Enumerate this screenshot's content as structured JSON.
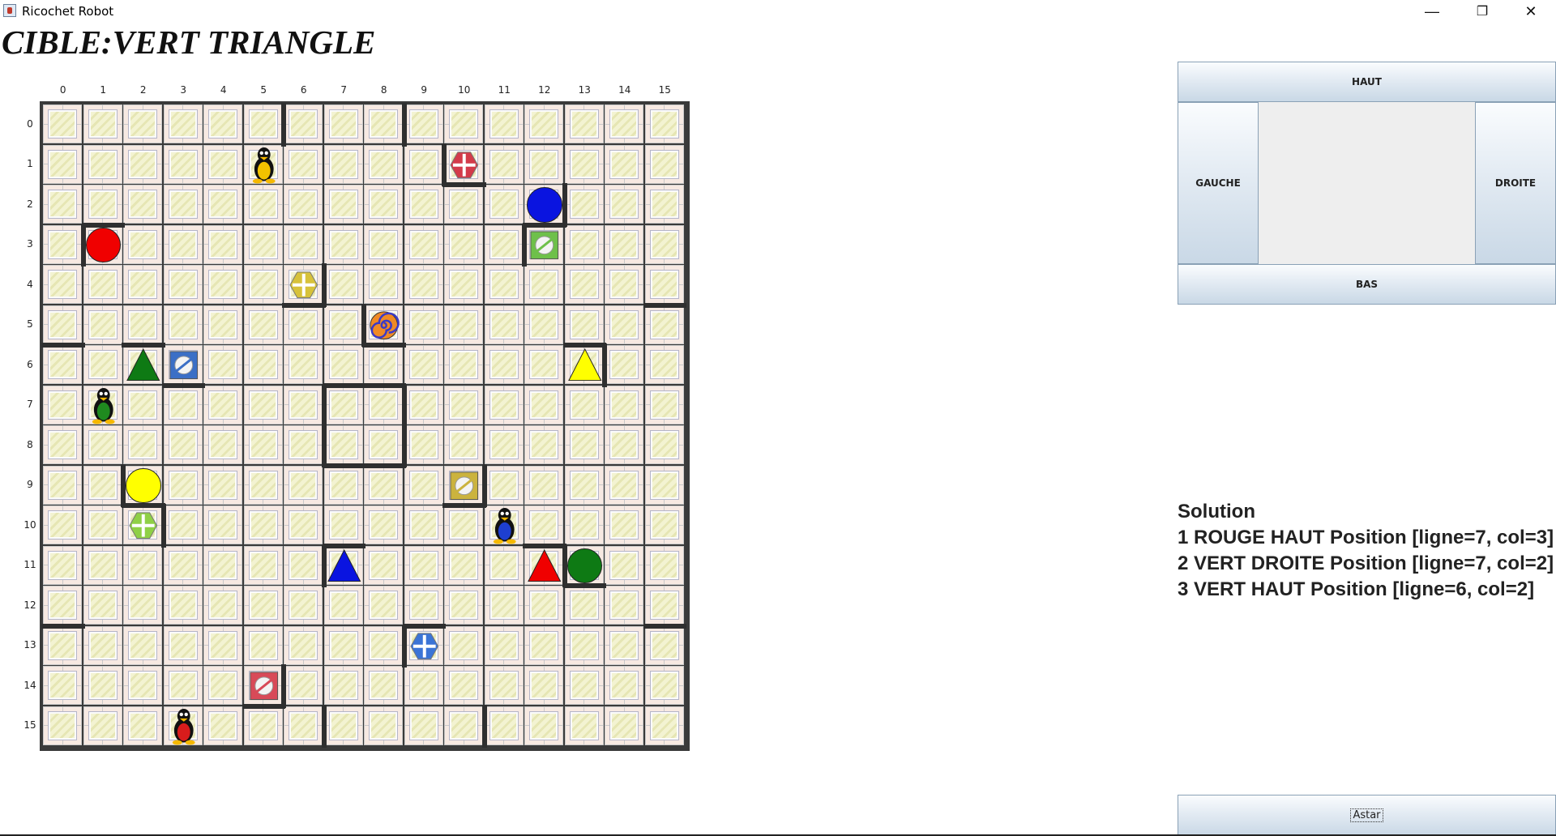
{
  "window": {
    "title": "Ricochet Robot",
    "minimize_glyph": "—",
    "restore_glyph": "❐",
    "close_glyph": "✕"
  },
  "cible_text": "CIBLE:VERT TRIANGLE",
  "board": {
    "size": 16,
    "column_labels": [
      "0",
      "1",
      "2",
      "3",
      "4",
      "5",
      "6",
      "7",
      "8",
      "9",
      "10",
      "11",
      "12",
      "13",
      "14",
      "15"
    ],
    "row_labels": [
      "0",
      "1",
      "2",
      "3",
      "4",
      "5",
      "6",
      "7",
      "8",
      "9",
      "10",
      "11",
      "12",
      "13",
      "14",
      "15"
    ],
    "robots": [
      {
        "name": "robot-yellow-penguin",
        "color": "#f2c200",
        "row": 1,
        "col": 5
      },
      {
        "name": "robot-green-penguin",
        "color": "#1f8a1f",
        "row": 7,
        "col": 1
      },
      {
        "name": "robot-blue-penguin",
        "color": "#1e3fd0",
        "row": 10,
        "col": 11
      },
      {
        "name": "robot-red-penguin",
        "color": "#d81c1c",
        "row": 15,
        "col": 3
      }
    ],
    "targets": [
      {
        "name": "target-red-cross",
        "shape": "cross-hex",
        "color": "#d33b4a",
        "row": 1,
        "col": 10
      },
      {
        "name": "target-blue-circle",
        "shape": "circle",
        "color": "#0a14e0",
        "row": 2,
        "col": 12
      },
      {
        "name": "target-red-circle",
        "shape": "circle",
        "color": "#f00000",
        "row": 3,
        "col": 1
      },
      {
        "name": "target-green-planet",
        "shape": "planet-square",
        "color": "#6ec04a",
        "row": 3,
        "col": 12
      },
      {
        "name": "target-yellow-cross",
        "shape": "cross-hex",
        "color": "#d7c23a",
        "row": 4,
        "col": 6
      },
      {
        "name": "target-vortex",
        "shape": "vortex",
        "color": "#e06a1a",
        "row": 5,
        "col": 8
      },
      {
        "name": "target-green-triangle",
        "shape": "triangle",
        "color": "#0e7a14",
        "row": 6,
        "col": 2
      },
      {
        "name": "target-blue-planet",
        "shape": "planet-square",
        "color": "#3b6fc6",
        "row": 6,
        "col": 3
      },
      {
        "name": "target-yellow-triangle",
        "shape": "triangle",
        "color": "#ffff00",
        "row": 6,
        "col": 13
      },
      {
        "name": "target-yellow-circle",
        "shape": "circle",
        "color": "#ffff00",
        "row": 9,
        "col": 2
      },
      {
        "name": "target-yellow-planet",
        "shape": "planet-square",
        "color": "#cbb33e",
        "row": 9,
        "col": 10
      },
      {
        "name": "target-green-cross",
        "shape": "cross-hex",
        "color": "#8fd046",
        "row": 10,
        "col": 2
      },
      {
        "name": "target-blue-triangle",
        "shape": "triangle",
        "color": "#0a14e0",
        "row": 11,
        "col": 7
      },
      {
        "name": "target-red-triangle",
        "shape": "triangle",
        "color": "#f00000",
        "row": 11,
        "col": 12
      },
      {
        "name": "target-green-circle",
        "shape": "circle",
        "color": "#0e7a14",
        "row": 11,
        "col": 13
      },
      {
        "name": "target-blue-cross",
        "shape": "cross-hex",
        "color": "#3b74d6",
        "row": 13,
        "col": 9
      },
      {
        "name": "target-red-planet",
        "shape": "planet-square",
        "color": "#d84a58",
        "row": 14,
        "col": 5
      }
    ],
    "walls": [
      {
        "row": 0,
        "col": 5,
        "side": "right"
      },
      {
        "row": 0,
        "col": 8,
        "side": "right"
      },
      {
        "row": 1,
        "col": 9,
        "side": "right"
      },
      {
        "row": 1,
        "col": 10,
        "side": "bottom"
      },
      {
        "row": 2,
        "col": 12,
        "side": "right"
      },
      {
        "row": 2,
        "col": 12,
        "side": "bottom"
      },
      {
        "row": 3,
        "col": 1,
        "side": "top"
      },
      {
        "row": 3,
        "col": 1,
        "side": "left"
      },
      {
        "row": 3,
        "col": 12,
        "side": "left"
      },
      {
        "row": 4,
        "col": 6,
        "side": "right"
      },
      {
        "row": 4,
        "col": 6,
        "side": "bottom"
      },
      {
        "row": 4,
        "col": 15,
        "side": "bottom"
      },
      {
        "row": 5,
        "col": 0,
        "side": "bottom"
      },
      {
        "row": 5,
        "col": 8,
        "side": "left"
      },
      {
        "row": 5,
        "col": 8,
        "side": "bottom"
      },
      {
        "row": 6,
        "col": 2,
        "side": "top"
      },
      {
        "row": 6,
        "col": 3,
        "side": "bottom"
      },
      {
        "row": 6,
        "col": 13,
        "side": "top"
      },
      {
        "row": 6,
        "col": 13,
        "side": "right"
      },
      {
        "row": 7,
        "col": 7,
        "side": "top"
      },
      {
        "row": 7,
        "col": 8,
        "side": "top"
      },
      {
        "row": 7,
        "col": 7,
        "side": "left"
      },
      {
        "row": 8,
        "col": 7,
        "side": "left"
      },
      {
        "row": 7,
        "col": 8,
        "side": "right"
      },
      {
        "row": 8,
        "col": 8,
        "side": "right"
      },
      {
        "row": 8,
        "col": 7,
        "side": "bottom"
      },
      {
        "row": 8,
        "col": 8,
        "side": "bottom"
      },
      {
        "row": 9,
        "col": 2,
        "side": "left"
      },
      {
        "row": 9,
        "col": 2,
        "side": "bottom"
      },
      {
        "row": 9,
        "col": 10,
        "side": "right"
      },
      {
        "row": 9,
        "col": 10,
        "side": "bottom"
      },
      {
        "row": 10,
        "col": 2,
        "side": "right"
      },
      {
        "row": 11,
        "col": 7,
        "side": "top"
      },
      {
        "row": 11,
        "col": 7,
        "side": "left"
      },
      {
        "row": 11,
        "col": 12,
        "side": "top"
      },
      {
        "row": 11,
        "col": 13,
        "side": "left"
      },
      {
        "row": 11,
        "col": 13,
        "side": "bottom"
      },
      {
        "row": 12,
        "col": 0,
        "side": "bottom"
      },
      {
        "row": 12,
        "col": 15,
        "side": "bottom"
      },
      {
        "row": 13,
        "col": 9,
        "side": "top"
      },
      {
        "row": 13,
        "col": 9,
        "side": "left"
      },
      {
        "row": 14,
        "col": 5,
        "side": "right"
      },
      {
        "row": 14,
        "col": 5,
        "side": "bottom"
      },
      {
        "row": 15,
        "col": 6,
        "side": "right"
      },
      {
        "row": 15,
        "col": 10,
        "side": "right"
      }
    ]
  },
  "controls": {
    "haut": "HAUT",
    "gauche": "GAUCHE",
    "droite": "DROITE",
    "bas": "BAS"
  },
  "solution": {
    "title": "Solution",
    "steps": [
      "1 ROUGE HAUT Position [ligne=7, col=3]",
      "2 VERT DROITE Position [ligne=7, col=2]",
      "3 VERT HAUT Position [ligne=6, col=2]"
    ]
  },
  "astar_label": "Astar"
}
